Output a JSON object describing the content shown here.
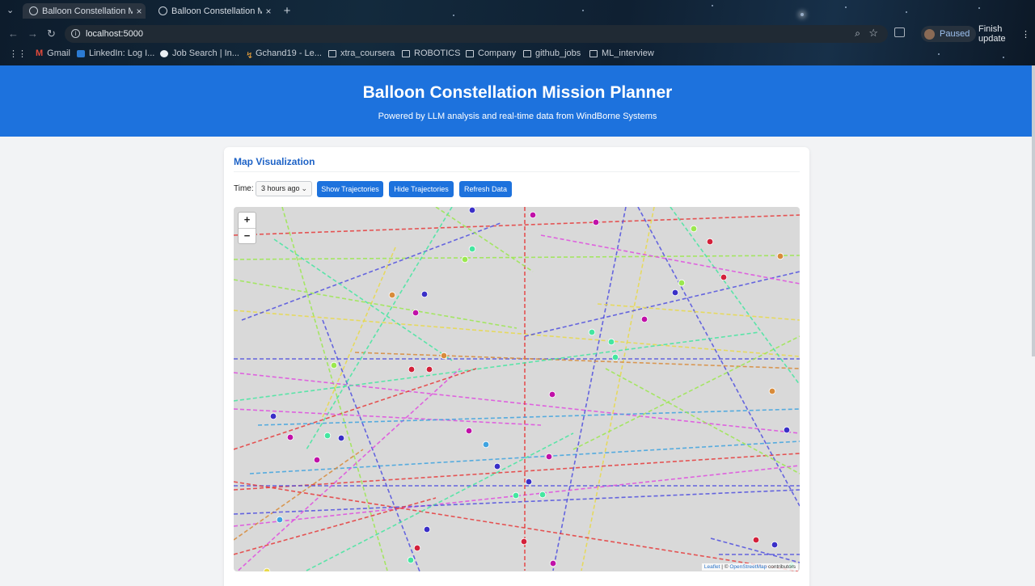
{
  "browser": {
    "tabs": [
      {
        "title": "Balloon Constellation Mi",
        "active": true
      },
      {
        "title": "Balloon Constellation M",
        "active": false
      }
    ],
    "url": "localhost:5000",
    "profile_status": "Paused",
    "update_label": "Finish update",
    "bookmarks": [
      {
        "label": "Gmail",
        "icon": "gmail-icon"
      },
      {
        "label": "LinkedIn: Log I...",
        "icon": "linkedin-icon"
      },
      {
        "label": "Job Search | In...",
        "icon": "info-icon"
      },
      {
        "label": "Gchand19 - Le...",
        "icon": "leetcode-icon"
      },
      {
        "label": "xtra_coursera",
        "icon": "folder-icon"
      },
      {
        "label": "ROBOTICS",
        "icon": "folder-icon"
      },
      {
        "label": "Company",
        "icon": "folder-icon"
      },
      {
        "label": "github_jobs",
        "icon": "folder-icon"
      },
      {
        "label": "ML_interview",
        "icon": "folder-icon"
      }
    ]
  },
  "header": {
    "title": "Balloon Constellation Mission Planner",
    "subtitle": "Powered by LLM analysis and real-time data from WindBorne Systems"
  },
  "map_section": {
    "heading": "Map Visualization",
    "time_label": "Time:",
    "time_selected": "3 hours ago",
    "buttons": {
      "show": "Show Trajectories",
      "hide": "Hide Trajectories",
      "refresh": "Refresh Data"
    },
    "zoom_in": "+",
    "zoom_out": "−",
    "attribution": {
      "leaflet": "Leaflet",
      "sep": " | © ",
      "osm": "OpenStreetMap",
      "suffix": " contributors"
    }
  },
  "colors": {
    "brand_blue": "#1d72dd",
    "map_bg": "#d9d9d9",
    "trajectory_palette": [
      "#e63b3b",
      "#5050e0",
      "#e04ee0",
      "#9be84f",
      "#44e6a0",
      "#e8d94a",
      "#3fa3e0",
      "#d88b3a"
    ]
  }
}
